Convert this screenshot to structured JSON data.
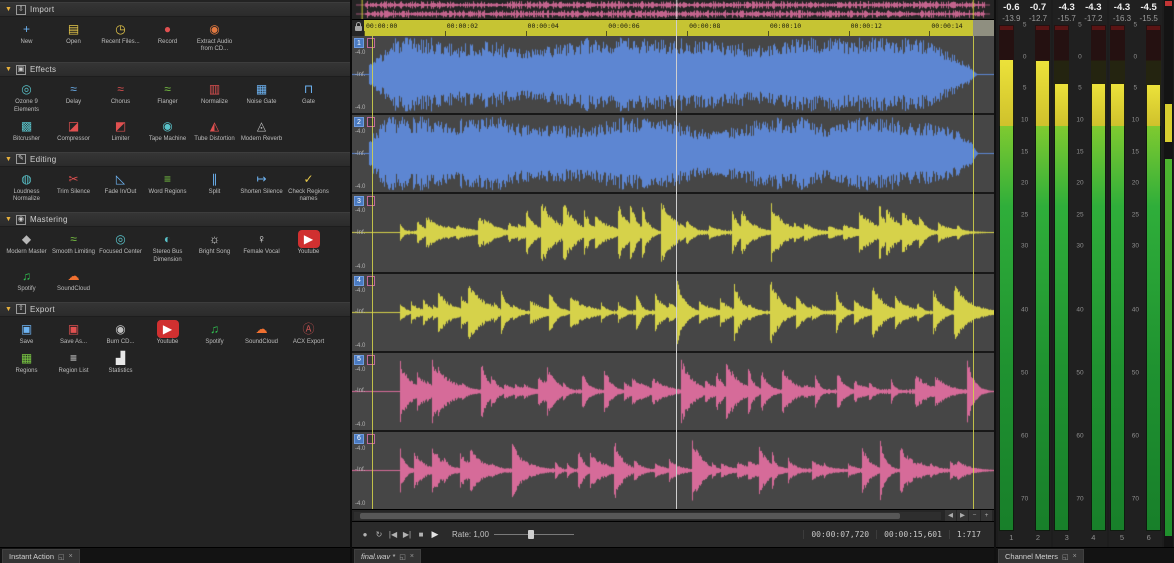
{
  "colors": {
    "selection_yellow": "#c9c93a",
    "wave_blue": "#5d86d2",
    "wave_yellow": "#d6d24a",
    "wave_pink": "#d66b99"
  },
  "icons": {
    "chevron-down-icon": "▼",
    "import-icon": "⇩",
    "effects-icon": "▣",
    "editing-icon": "✎",
    "mastering-icon": "◉",
    "export-icon": "⇧",
    "new-file-icon": "+",
    "open-folder-icon": "▤",
    "recent-files-icon": "◷",
    "record-icon": "●",
    "extract-cd-icon": "◉",
    "ozone-icon": "◎",
    "delay-icon": "≈",
    "chorus-icon": "≈",
    "flanger-icon": "≈",
    "normalize-icon": "▥",
    "noise-gate-icon": "▦",
    "gate-icon": "⊓",
    "bitcrusher-icon": "▩",
    "compressor-icon": "◪",
    "limiter-icon": "◩",
    "tape-machine-icon": "◉",
    "tube-distortion-icon": "◭",
    "modern-reverb-icon": "◬",
    "loudness-normalize-icon": "◍",
    "trim-silence-icon": "✂",
    "fade-icon": "◺",
    "word-regions-icon": "≡",
    "split-icon": "∥",
    "shorten-silence-icon": "↦",
    "check-regions-icon": "✓",
    "modern-master-icon": "◆",
    "smooth-limiting-icon": "≈",
    "focused-center-icon": "◎",
    "stereo-bus-icon": "◐",
    "bright-song-icon": "☼",
    "female-vocal-icon": "♀",
    "youtube-icon": "▶",
    "spotify-icon": "♫",
    "soundcloud-icon": "☁",
    "save-icon": "▣",
    "save-as-icon": "▣",
    "burn-cd-icon": "◉",
    "acx-export-icon": "Ⓐ",
    "regions-icon": "▦",
    "region-list-icon": "≡",
    "statistics-icon": "▟",
    "loop-icon": "↻",
    "go-start-icon": "|◀",
    "go-end-icon": "▶|",
    "stop-icon": "■",
    "play-icon": "▶",
    "float-icon": "◱",
    "close-icon": "×",
    "scroll-left-icon": "◀",
    "scroll-right-icon": "▶",
    "zoom-out-icon": "−",
    "zoom-in-icon": "+"
  },
  "left_panel": {
    "tab": {
      "label": "Instant Action"
    },
    "sections": [
      {
        "label": "Import",
        "icon": "import-icon",
        "items": [
          {
            "label": "New",
            "icon": "new-file-icon",
            "color": "#6db3f2"
          },
          {
            "label": "Open",
            "icon": "open-folder-icon",
            "color": "#e8c94a"
          },
          {
            "label": "Recent Files...",
            "icon": "recent-files-icon",
            "color": "#e8c94a"
          },
          {
            "label": "Record",
            "icon": "record-icon",
            "color": "#e05050"
          },
          {
            "label": "Extract Audio from CD...",
            "icon": "extract-cd-icon",
            "color": "#e07840"
          }
        ]
      },
      {
        "label": "Effects",
        "icon": "effects-icon",
        "items": [
          {
            "label": "Ozone 9 Elements",
            "icon": "ozone-icon",
            "color": "#59c2c9"
          },
          {
            "label": "Delay",
            "icon": "delay-icon",
            "color": "#6db3f2"
          },
          {
            "label": "Chorus",
            "icon": "chorus-icon",
            "color": "#e05050"
          },
          {
            "label": "Flanger",
            "icon": "flanger-icon",
            "color": "#7ac943"
          },
          {
            "label": "Normalize",
            "icon": "normalize-icon",
            "color": "#e05050"
          },
          {
            "label": "Noise Gate",
            "icon": "noise-gate-icon",
            "color": "#6db3f2"
          },
          {
            "label": "Gate",
            "icon": "gate-icon",
            "color": "#6db3f2"
          },
          {
            "label": "Bitcrusher",
            "icon": "bitcrusher-icon",
            "color": "#59c2c9"
          },
          {
            "label": "Compressor",
            "icon": "compressor-icon",
            "color": "#e05050"
          },
          {
            "label": "Limiter",
            "icon": "limiter-icon",
            "color": "#e05050"
          },
          {
            "label": "Tape Machine",
            "icon": "tape-machine-icon",
            "color": "#59c2c9"
          },
          {
            "label": "Tube Distortion",
            "icon": "tube-distortion-icon",
            "color": "#e05050"
          },
          {
            "label": "Modern Reverb",
            "icon": "modern-reverb-icon",
            "color": "#b8b8b8"
          }
        ]
      },
      {
        "label": "Editing",
        "icon": "editing-icon",
        "items": [
          {
            "label": "Loudness Normalize",
            "icon": "loudness-normalize-icon",
            "color": "#59c2c9"
          },
          {
            "label": "Trim Silence",
            "icon": "trim-silence-icon",
            "color": "#e05050"
          },
          {
            "label": "Fade In/Out",
            "icon": "fade-icon",
            "color": "#6db3f2"
          },
          {
            "label": "Word Regions",
            "icon": "word-regions-icon",
            "color": "#7ac943"
          },
          {
            "label": "Split",
            "icon": "split-icon",
            "color": "#6db3f2"
          },
          {
            "label": "Shorten Silence",
            "icon": "shorten-silence-icon",
            "color": "#6db3f2"
          },
          {
            "label": "Check Regions names",
            "icon": "check-regions-icon",
            "color": "#e8c94a"
          }
        ]
      },
      {
        "label": "Mastering",
        "icon": "mastering-icon",
        "items": [
          {
            "label": "Modern Master",
            "icon": "modern-master-icon",
            "color": "#b8b8b8"
          },
          {
            "label": "Smooth Limiting",
            "icon": "smooth-limiting-icon",
            "color": "#7ac943"
          },
          {
            "label": "Focused Center",
            "icon": "focused-center-icon",
            "color": "#59c2c9"
          },
          {
            "label": "Stereo Bus Dimension",
            "icon": "stereo-bus-icon",
            "color": "#59c2c9"
          },
          {
            "label": "Bright Song",
            "icon": "bright-song-icon",
            "color": "#e8e8e8"
          },
          {
            "label": "Female Vocal",
            "icon": "female-vocal-icon",
            "color": "#e8e8e8"
          },
          {
            "label": "Youtube",
            "icon": "youtube-icon",
            "color": "#ffffff",
            "bg": "#d03030"
          },
          {
            "label": "Spotify",
            "icon": "spotify-icon",
            "color": "#30c050"
          },
          {
            "label": "SoundCloud",
            "icon": "soundcloud-icon",
            "color": "#f07030"
          }
        ]
      },
      {
        "label": "Export",
        "icon": "export-icon",
        "items": [
          {
            "label": "Save",
            "icon": "save-icon",
            "color": "#6db3f2"
          },
          {
            "label": "Save As...",
            "icon": "save-as-icon",
            "color": "#e05050"
          },
          {
            "label": "Burn CD...",
            "icon": "burn-cd-icon",
            "color": "#c0c0c0"
          },
          {
            "label": "Youtube",
            "icon": "youtube-icon",
            "color": "#ffffff",
            "bg": "#d03030"
          },
          {
            "label": "Spotify",
            "icon": "spotify-icon",
            "color": "#30c050"
          },
          {
            "label": "SoundCloud",
            "icon": "soundcloud-icon",
            "color": "#f07030"
          },
          {
            "label": "ACX Export",
            "icon": "acx-export-icon",
            "color": "#c05050"
          },
          {
            "label": "Regions",
            "icon": "regions-icon",
            "color": "#7ac943"
          },
          {
            "label": "Region List",
            "icon": "region-list-icon",
            "color": "#e8e8e8"
          },
          {
            "label": "Statistics",
            "icon": "statistics-icon",
            "color": "#e8e8e8"
          }
        ]
      }
    ]
  },
  "editor": {
    "ruler": {
      "times": [
        "00:00:00",
        "00:00:02",
        "00:00:04",
        "00:00:06",
        "00:00:08",
        "00:00:10",
        "00:00:12",
        "00:00:14"
      ],
      "visible_seconds": 15.6
    },
    "channels": [
      {
        "number": "1",
        "color": "#5d86d2",
        "style": "sustained",
        "db_top": "-4.0",
        "db_mid": "-Inf.",
        "db_bottom": "-4.0"
      },
      {
        "number": "2",
        "color": "#5d86d2",
        "style": "sustained",
        "db_top": "-4.0",
        "db_mid": "-Inf.",
        "db_bottom": "-4.0"
      },
      {
        "number": "3",
        "color": "#d6d24a",
        "style": "percussive",
        "db_top": "-4.0",
        "db_mid": "-Inf.",
        "db_bottom": "-4.0"
      },
      {
        "number": "4",
        "color": "#d6d24a",
        "style": "percussive",
        "db_top": "-4.0",
        "db_mid": "-Inf.",
        "db_bottom": "-4.0"
      },
      {
        "number": "5",
        "color": "#d66b99",
        "style": "percussive",
        "db_top": "-4.0",
        "db_mid": "-Inf.",
        "db_bottom": "-4.0"
      },
      {
        "number": "6",
        "color": "#d66b99",
        "style": "percussive",
        "db_top": "-4.0",
        "db_mid": "-Inf.",
        "db_bottom": "-4.0"
      }
    ],
    "transport": {
      "rate_label": "Rate: 1,00",
      "time_position": "00:00:07,720",
      "time_end": "00:00:15,601",
      "time_counter": "1:717"
    },
    "file_tab": {
      "label": "final.wav *"
    }
  },
  "meters": {
    "tab": {
      "label": "Channel Meters"
    },
    "scale": [
      {
        "label": "5",
        "db": 5
      },
      {
        "label": "0",
        "db": 0
      },
      {
        "label": "5",
        "db": -5
      },
      {
        "label": "10",
        "db": -10
      },
      {
        "label": "15",
        "db": -15
      },
      {
        "label": "20",
        "db": -20
      },
      {
        "label": "25",
        "db": -25
      },
      {
        "label": "30",
        "db": -30
      },
      {
        "label": "40",
        "db": -40
      },
      {
        "label": "50",
        "db": -50
      },
      {
        "label": "60",
        "db": -60
      },
      {
        "label": "70",
        "db": -70
      }
    ],
    "groups": [
      {
        "peak_labels": [
          "-0.6",
          "-0.7"
        ],
        "rms_labels": [
          "-13.9",
          "-12.7"
        ],
        "peaks_db": [
          -0.6,
          -0.7
        ],
        "channel_labels": [
          "1",
          "2"
        ]
      },
      {
        "peak_labels": [
          "-4.3",
          "-4.3"
        ],
        "rms_labels": [
          "-15.7",
          "-17.2"
        ],
        "peaks_db": [
          -4.3,
          -4.3
        ],
        "channel_labels": [
          "3",
          "4"
        ]
      },
      {
        "peak_labels": [
          "-4.3",
          "-4.5"
        ],
        "rms_labels": [
          "-16.3",
          "-15.5"
        ],
        "peaks_db": [
          -4.3,
          -4.5
        ],
        "channel_labels": [
          "5",
          "6"
        ]
      }
    ]
  }
}
